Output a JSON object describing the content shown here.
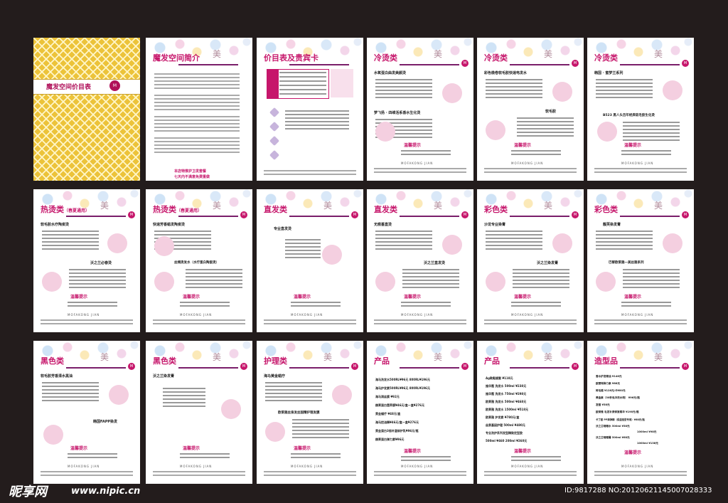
{
  "cover": {
    "title": "魔发空间价目表",
    "badge": "M"
  },
  "logo": {
    "glyph": "美",
    "badge": "M"
  },
  "pages": {
    "intro": {
      "title": "魔发空间简介",
      "closing1": "本店特推护卫发套餐",
      "closing2": "七天内不满意免费重做"
    },
    "price": {
      "title": "价目表及贵宾卡"
    },
    "perm1": {
      "title": "冷烫类",
      "item1": "水氧蛋白曲发美颜烫",
      "item2": "梦飞扬 · 四维活系香水生化烫"
    },
    "perm2": {
      "title": "冷烫类",
      "item1": "彩色微卷软毛胶快速电发水",
      "item2": "软毛胶"
    },
    "perm3": {
      "title": "冷烫类",
      "item1": "韩国 · 蜜梦兰系列",
      "item2": "B523 黑人头百年经典软毛胶生化烫"
    },
    "hot1": {
      "title": "热烫类",
      "sub": "（春夏通用）",
      "item1": "软毛胶水疗陶瓷烫",
      "item2": "沃之兰必春烫"
    },
    "hot2": {
      "title": "热烫类",
      "sub": "（春夏通用）",
      "item1": "快速芳香蜡发陶瓷烫",
      "item2": "丝绸烫发水（水疗蛋白陶瓷烫）"
    },
    "straight1": {
      "title": "直发类",
      "item1": "专业直发烫"
    },
    "straight2": {
      "title": "直发类",
      "item1": "无痕垂直烫",
      "item2": "沃之兰直发烫"
    },
    "color1": {
      "title": "彩色类",
      "item1": "沙龙专业染膏",
      "item2": "沃之兰染发膏"
    },
    "color2": {
      "title": "彩色类",
      "item1": "靓芙染发膏",
      "item2": "巴黎欧莱雅—美丝雅系列"
    },
    "black1": {
      "title": "黑色类",
      "item1": "软毛胶芳香清水黑油",
      "item2": "韩国FAPP染发"
    },
    "black2": {
      "title": "黑色类",
      "item1": "沃之兰染发膏"
    },
    "care": {
      "title": "护理类",
      "item1": "海马黄金蜡疗",
      "item2": "欧莱雅丝泉发丝固精护理发膜"
    },
    "prod1": {
      "title": "产品",
      "rows": [
        "海马洗发水500RL¥96元 800RL¥196元",
        "海马护发素500RL¥96元 800RL¥196元",
        "海马润丝膜 ¥92元",
        "赫莱蛋白营养膜¥46元/盒—盒¥276元",
        "黄金蜡疗 ¥48元/盒",
        "海马控油精¥46元/盒—盒¥276元",
        "黄金蛋白3倍补湿修护乳¥96元/瓶",
        "赫莱蛋白弹力素¥96元"
      ]
    },
    "prod2": {
      "title": "产品",
      "rows": [
        "Ag軟鬆顺髮 ¥118元",
        "施华蔻 洗发水 500ml ¥238元",
        "施华蔻 洗发水 750ml ¥298元",
        "欧莱雅 洗发水 500ml ¥468元",
        "欧莱雅 洗发水 1500ml ¥518元",
        "欧莱雅 护发素 ¥780元/盒",
        "丝泉基因护理 500ml ¥480元",
        "专业洗护系列发型精致定型胶",
        "500ml ¥460 200ml ¥260元"
      ]
    },
    "styling": {
      "title": "造型品",
      "rows": [
        "香水护发精油 ¥148元",
        "欧丽特弹力素 ¥88元",
        "碎毛蜡 ¥128元/卡¥80元",
        "黄金素（30秒免冲洗水喷） ¥96元/瓶",
        "发蜡 ¥58元",
        "欧莱雅 毛发补原修复精华 ¥198元/瓶",
        "卡丁甜 PP淋弹精（保湿造型专用）¥68元/瓶",
        "沃之兰啫喱水 500ml ¥58元",
        "1000ml ¥98元",
        "沃之兰啫喱膏 500ml ¥68元",
        "1000ml ¥138元"
      ]
    }
  },
  "common": {
    "notice": "温馨提示",
    "notice_line": "为了您头发的健康与美丽，建议您定期做头发护理",
    "footer": "MOFAKONG JIAN"
  },
  "watermark": {
    "brand": "昵享网",
    "url": "www.nipic.cn",
    "id": "ID:9817288 NO:20120621145007028333"
  },
  "colors": {
    "accent": "#c6166b",
    "cover": "#ecc33a",
    "background": "#231c1c"
  }
}
